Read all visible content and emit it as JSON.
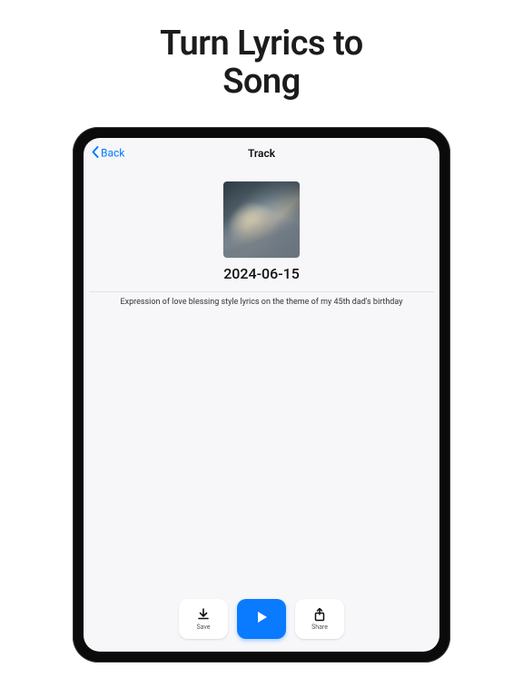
{
  "headline_line1": "Turn Lyrics to",
  "headline_line2": "Song",
  "nav": {
    "back_label": "Back",
    "title": "Track"
  },
  "track": {
    "date": "2024-06-15",
    "description": "Expression of love blessing style lyrics on the theme of my 45th dad's birthday"
  },
  "actions": {
    "save_label": "Save",
    "share_label": "Share"
  }
}
